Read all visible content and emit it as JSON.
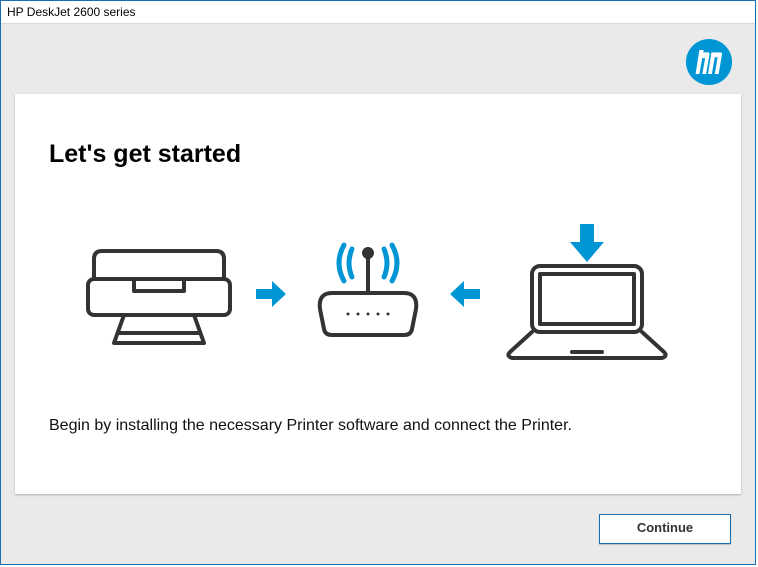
{
  "window": {
    "title": "HP DeskJet 2600 series"
  },
  "brand": {
    "logo_name": "hp-logo",
    "accent": "#0096d6"
  },
  "main": {
    "heading": "Let's get started",
    "description": "Begin by installing the necessary Printer software and connect the Printer."
  },
  "illustration": {
    "printer_icon": "printer-icon",
    "router_icon": "wifi-router-icon",
    "laptop_icon": "laptop-icon",
    "arrow_icon": "arrow-icon"
  },
  "buttons": {
    "continue": "Continue"
  }
}
